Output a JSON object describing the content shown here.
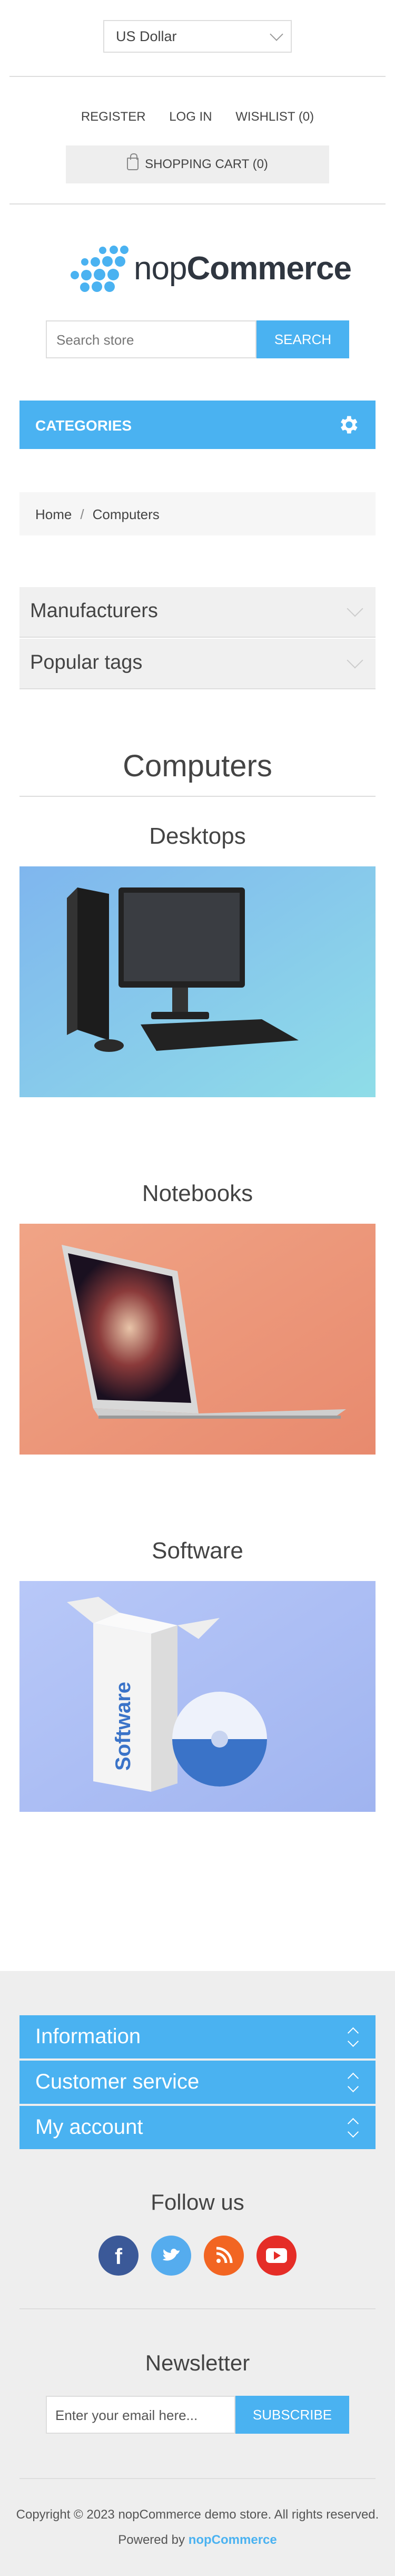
{
  "header": {
    "currency": "US Dollar",
    "links": [
      {
        "label": "Register"
      },
      {
        "label": "Log in"
      },
      {
        "label": "Wishlist (0)"
      }
    ],
    "cart_label": "Shopping cart (0)"
  },
  "logo": {
    "prefix": "nop",
    "suffix": "Commerce"
  },
  "search": {
    "placeholder": "Search store",
    "button": "Search"
  },
  "categories_label": "Categories",
  "breadcrumb": {
    "home": "Home",
    "separator": "/",
    "current": "Computers"
  },
  "side_blocks": [
    {
      "label": "Manufacturers"
    },
    {
      "label": "Popular tags"
    }
  ],
  "page_title": "Computers",
  "subcategories": [
    {
      "title": "Desktops"
    },
    {
      "title": "Notebooks"
    },
    {
      "title": "Software"
    }
  ],
  "footer": {
    "blocks": [
      {
        "label": "Information"
      },
      {
        "label": "Customer service"
      },
      {
        "label": "My account"
      }
    ],
    "follow_us": "Follow us",
    "social": [
      {
        "icon": "facebook-icon",
        "color": "#3b5998"
      },
      {
        "icon": "twitter-icon",
        "color": "#55acee"
      },
      {
        "icon": "rss-icon",
        "color": "#f26522"
      },
      {
        "icon": "youtube-icon",
        "color": "#e52d27"
      }
    ],
    "newsletter_title": "Newsletter",
    "newsletter_placeholder": "Enter your email here...",
    "subscribe_button": "Subscribe",
    "copyright": "Copyright © 2023 nopCommerce demo store. All rights reserved.",
    "powered_prefix": "Powered by",
    "powered_brand": "nopCommerce"
  },
  "colors": {
    "accent": "#4ab2f1",
    "footer_bg": "#eeeeee"
  }
}
